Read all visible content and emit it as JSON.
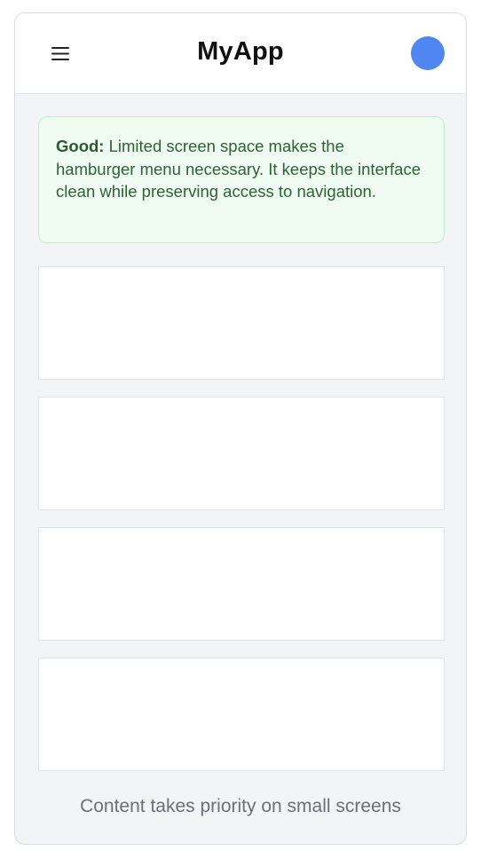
{
  "header": {
    "title": "MyApp",
    "menu_icon": "hamburger-icon",
    "avatar_color": "#4f86f1"
  },
  "callout": {
    "lead": "Good:",
    "text": " Limited screen space makes the hamburger menu necessary. It keeps the interface clean while preserving access to navigation."
  },
  "content": {
    "cards": [
      "",
      "",
      "",
      ""
    ]
  },
  "footer": {
    "text": "Content takes priority on small screens"
  },
  "colors": {
    "accent": "#4f86f1",
    "success_bg": "#f0fbf2",
    "success_text": "#2d6237"
  }
}
